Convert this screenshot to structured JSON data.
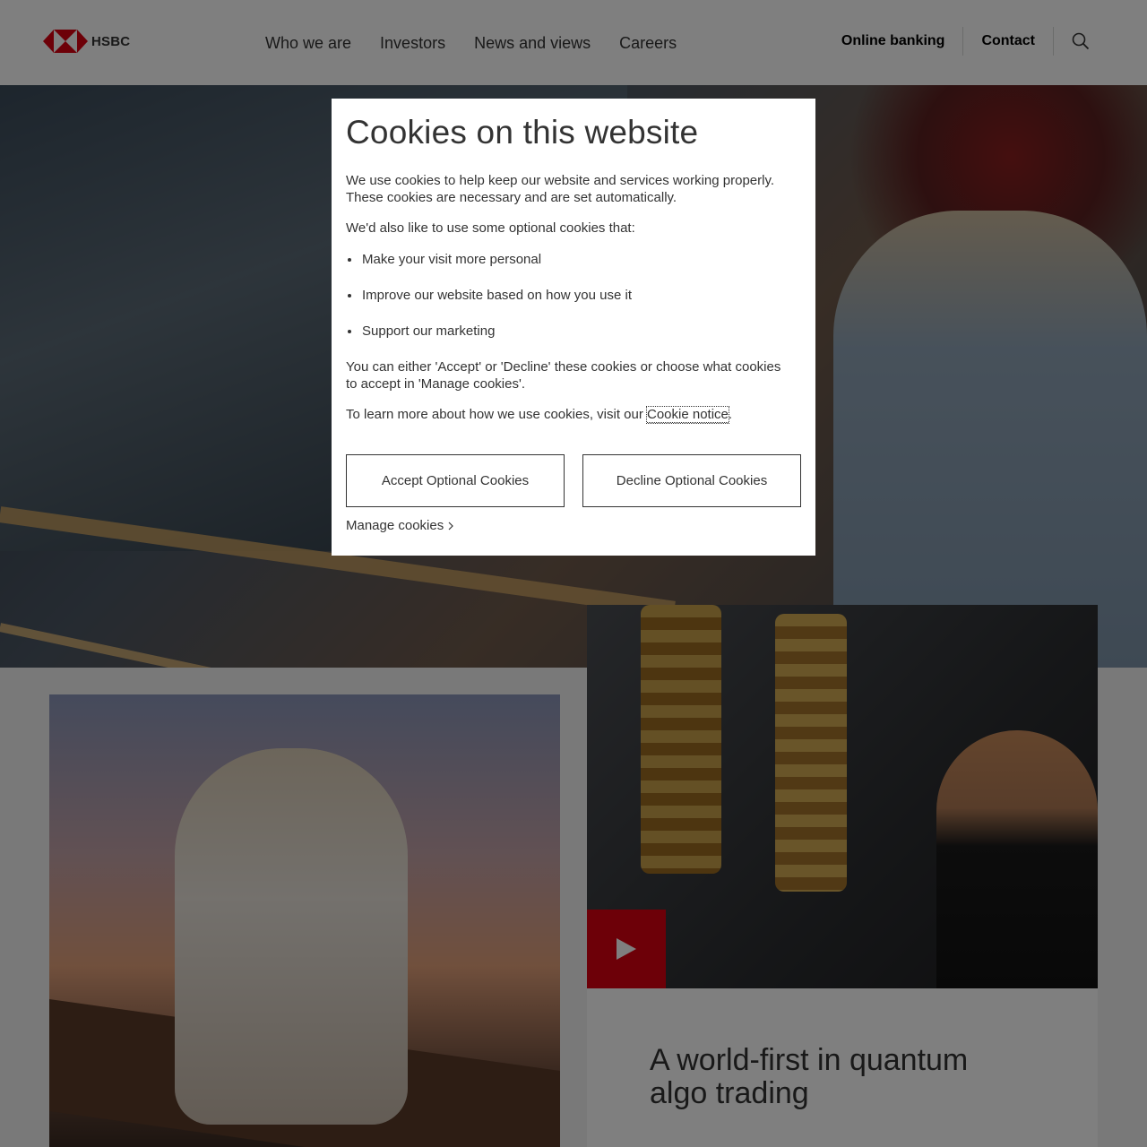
{
  "header": {
    "brand": "HSBC",
    "nav": [
      "Who we are",
      "Investors",
      "News and views",
      "Careers"
    ],
    "utility": [
      "Online banking",
      "Contact"
    ]
  },
  "colors": {
    "brand_red": "#db0011",
    "text": "#333333",
    "overlay": "rgba(0,0,0,0.5)"
  },
  "icons": {
    "logo": "hsbc-hexagon-logo-icon",
    "search": "search-icon",
    "play": "play-icon",
    "manage_chevron": "chevron-right-icon"
  },
  "cards": {
    "right_title": "A world-first in quantum algo trading"
  },
  "cookie_modal": {
    "title": "Cookies on this website",
    "intro": "We use cookies to help keep our website and services working properly. These cookies are necessary and are set automatically.",
    "optional_intro": "We'd also like to use some optional cookies that:",
    "bullets": [
      "Make your visit more personal",
      "Improve our website based on how you use it",
      "Support our marketing"
    ],
    "choice_text": "You can either 'Accept' or 'Decline' these cookies or choose what cookies to accept in 'Manage cookies'.",
    "learn_prefix": "To learn more about how we use cookies, visit our ",
    "learn_link": "Cookie notice",
    "learn_suffix": ".",
    "accept_label": "Accept Optional Cookies",
    "decline_label": "Decline Optional Cookies",
    "manage_label": "Manage cookies"
  }
}
